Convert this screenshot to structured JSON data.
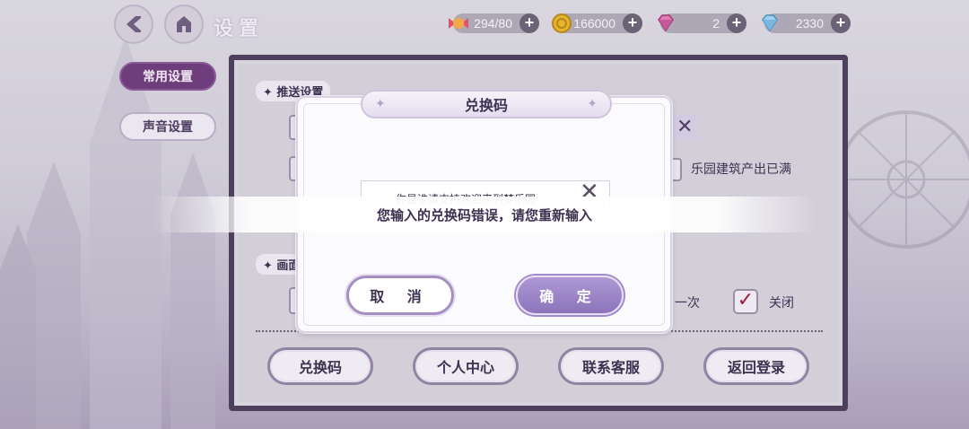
{
  "header": {
    "title": "设置",
    "back_icon": "back-arrow-icon",
    "home_icon": "castle-home-icon"
  },
  "resources": [
    {
      "name": "candy",
      "icon": "candy-icon",
      "value": "294/80"
    },
    {
      "name": "coin",
      "icon": "coin-icon",
      "value": "166000"
    },
    {
      "name": "pink-gem",
      "icon": "pink-diamond-icon",
      "value": "2"
    },
    {
      "name": "blue-gem",
      "icon": "blue-diamond-icon",
      "value": "2330"
    }
  ],
  "plus_label": "+",
  "sidebar": {
    "tabs": [
      {
        "label": "常用设置",
        "active": true
      },
      {
        "label": "声音设置",
        "active": false
      }
    ]
  },
  "settings": {
    "push_section_title": "推送设置",
    "display_section_title_partial": "画面",
    "notice_label": "乐园建筑产出已满",
    "once_partial": "一次",
    "close_label": "关闭",
    "close_checked": true
  },
  "bottom_buttons": [
    {
      "label": "兑换码"
    },
    {
      "label": "个人中心"
    },
    {
      "label": "联系客服"
    },
    {
      "label": "返回登录"
    }
  ],
  "dialog": {
    "title": "兑换码",
    "input_value": "你是谁请支持欢迎来到梦乐园",
    "cancel_label": "取 消",
    "confirm_label": "确 定"
  },
  "toast": {
    "message": "您输入的兑换码错误，请您重新输入"
  },
  "colors": {
    "accent": "#6e3e7c",
    "confirm": "#9a82c6",
    "panel_border": "#4e3f5c"
  }
}
